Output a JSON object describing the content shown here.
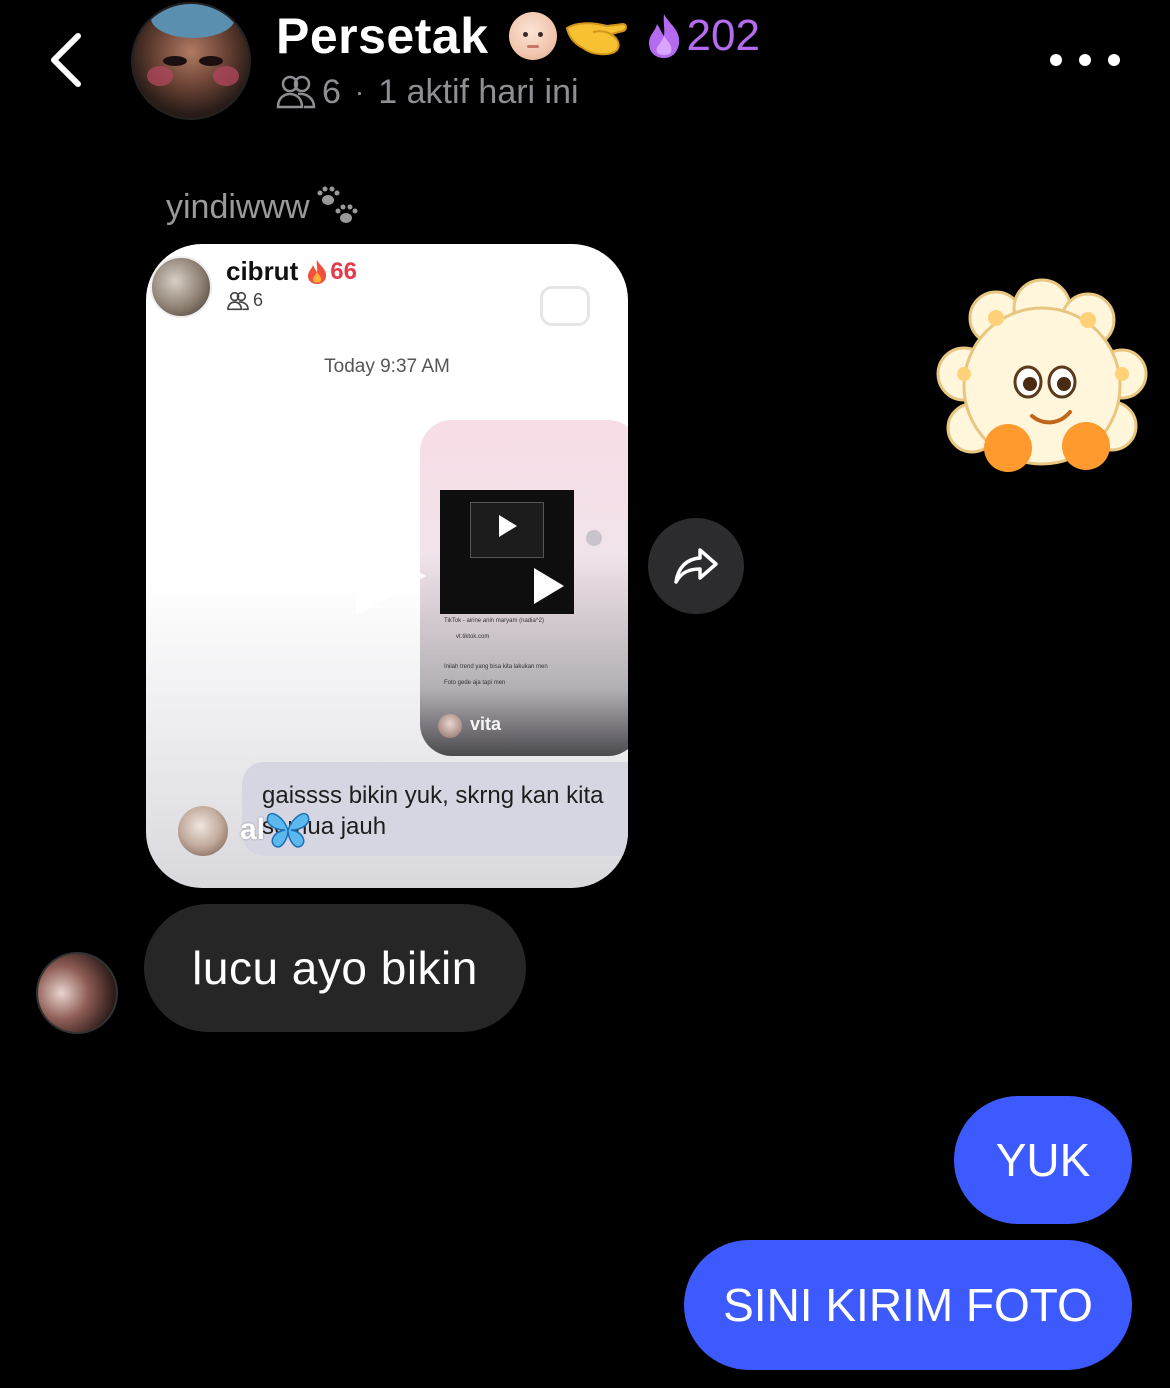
{
  "header": {
    "group_name": "Persetak",
    "streak_count": "202",
    "member_count": "6",
    "separator": "·",
    "activity": "1 aktif hari ini",
    "icons": [
      "back-chevron-icon",
      "baby-face-emoji",
      "pinching-hand-emoji",
      "purple-flame-icon",
      "members-icon",
      "more-icon"
    ]
  },
  "shared_post": {
    "sender": "yindiwww",
    "sender_emoji": "paw-prints-icon",
    "card": {
      "chat_name": "cibrut",
      "streak": "66",
      "members": "6",
      "timestamp": "Today 9:37 AM",
      "inner_sender": "vita",
      "inner_lines": [
        "TikTok - airine anin maryam (nadia^2)",
        "vt.tiktok.com",
        "Inilah trend yang bisa kita lakukan men",
        "Foto gede aja tapi men"
      ],
      "caption": "gaissss bikin yuk, skrng kan kita semua jauh",
      "caption_author": "al"
    }
  },
  "sticker": "popcorn-sticker",
  "messages": [
    {
      "from": "other",
      "text": "lucu ayo bikin"
    },
    {
      "from": "me",
      "text": "YUK"
    },
    {
      "from": "me",
      "text": "SINI KIRIM FOTO"
    }
  ],
  "colors": {
    "background": "#000000",
    "my_bubble": "#3d5afe",
    "their_bubble": "#262626",
    "streak_purple": "#b46bf0",
    "muted_text": "#8e8e93"
  }
}
